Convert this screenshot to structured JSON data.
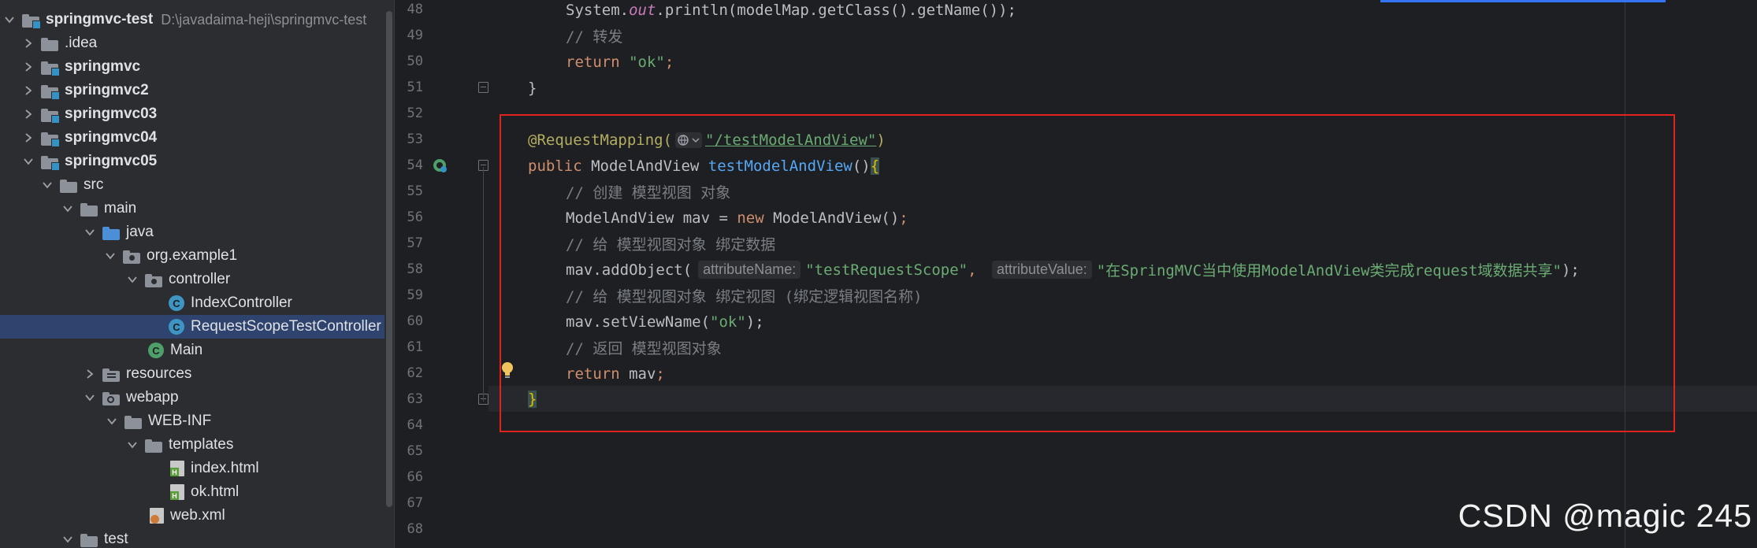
{
  "project_tree": {
    "root": {
      "label": "springmvc-test",
      "path": "D:\\javadaima-heji\\springmvc-test"
    },
    "items": [
      {
        "label": ".idea"
      },
      {
        "label": "springmvc"
      },
      {
        "label": "springmvc2"
      },
      {
        "label": "springmvc03"
      },
      {
        "label": "springmvc04"
      },
      {
        "label": "springmvc05"
      },
      {
        "label": "src"
      },
      {
        "label": "main"
      },
      {
        "label": "java"
      },
      {
        "label": "org.example1"
      },
      {
        "label": "controller"
      },
      {
        "label": "IndexController"
      },
      {
        "label": "RequestScopeTestController"
      },
      {
        "label": "Main"
      },
      {
        "label": "resources"
      },
      {
        "label": "webapp"
      },
      {
        "label": "WEB-INF"
      },
      {
        "label": "templates"
      },
      {
        "label": "index.html"
      },
      {
        "label": "ok.html"
      },
      {
        "label": "web.xml"
      },
      {
        "label": "test"
      }
    ]
  },
  "editor": {
    "line_numbers": [
      "48",
      "49",
      "50",
      "51",
      "52",
      "53",
      "54",
      "55",
      "56",
      "57",
      "58",
      "59",
      "60",
      "61",
      "62",
      "63",
      "64",
      "65",
      "66",
      "67",
      "68"
    ],
    "code": {
      "l48a": "System.",
      "l48b": "out",
      "l48c": ".println(modelMap.getClass().getName());",
      "l49": "// 转发",
      "l50a": "return ",
      "l50b": "\"ok\"",
      "l50c": ";",
      "l51": "}",
      "l53a": "@RequestMapping(",
      "l53b": "\"/testModelAndView\"",
      "l53c": ")",
      "l54a": "public ",
      "l54b": "ModelAndView ",
      "l54c": "testModelAndView",
      "l54d": "()",
      "l54e": "{",
      "l55": "// 创建 模型视图 对象",
      "l56a": "ModelAndView mav = ",
      "l56b": "new ",
      "l56c": "ModelAndView()",
      "l56d": ";",
      "l57": "// 给 模型视图对象 绑定数据",
      "l58a": "mav.addObject(",
      "l58hint1": "attributeName:",
      "l58b": "\"testRequestScope\"",
      "l58c": ", ",
      "l58hint2": "attributeValue:",
      "l58d": "\"在SpringMVC当中使用ModelAndView类完成request域数据共享\"",
      "l58e": ");",
      "l59": "// 给 模型视图对象 绑定视图 (绑定逻辑视图名称)",
      "l60a": "mav.setViewName(",
      "l60b": "\"ok\"",
      "l60c": ");",
      "l61": "// 返回 模型视图对象",
      "l62a": "return ",
      "l62b": "mav",
      "l62c": ";",
      "l63": "}"
    }
  },
  "watermark": "CSDN @magic 245",
  "colors": {
    "highlight_box": "#e0231f",
    "selection": "#2e436e",
    "keyword": "#cf8e6d",
    "string": "#6aab73",
    "annotation": "#b3ae60",
    "method": "#56a8f5",
    "comment": "#7a7e85"
  },
  "icons": {
    "folder": "folder-icon",
    "module": "module-folder-icon",
    "class": "java-class-icon",
    "html": "html-file-icon",
    "xml": "xml-file-icon",
    "bulb": "intention-bulb-icon",
    "web": "web-endpoint-icon"
  }
}
